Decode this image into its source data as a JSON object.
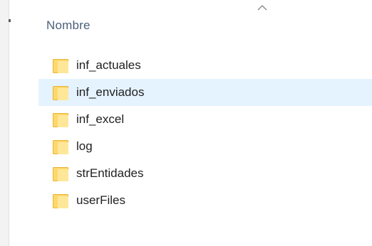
{
  "column_header": {
    "name_label": "Nombre",
    "sort_direction": "ascending"
  },
  "files": [
    {
      "name": "inf_actuales",
      "type": "folder-icon",
      "state": "normal"
    },
    {
      "name": "inf_enviados",
      "type": "folder-icon",
      "state": "hover"
    },
    {
      "name": "inf_excel",
      "type": "folder-icon",
      "state": "normal"
    },
    {
      "name": "log",
      "type": "folder-icon",
      "state": "normal"
    },
    {
      "name": "strEntidades",
      "type": "folder-icon",
      "state": "normal"
    },
    {
      "name": "userFiles",
      "type": "folder-icon",
      "state": "normal"
    }
  ],
  "colors": {
    "header_text": "#4c607a",
    "hover_row": "#e5f3ff",
    "folder_body": "#ffd86b",
    "folder_front": "#ffe79a",
    "folder_edge": "#e5b53a"
  }
}
